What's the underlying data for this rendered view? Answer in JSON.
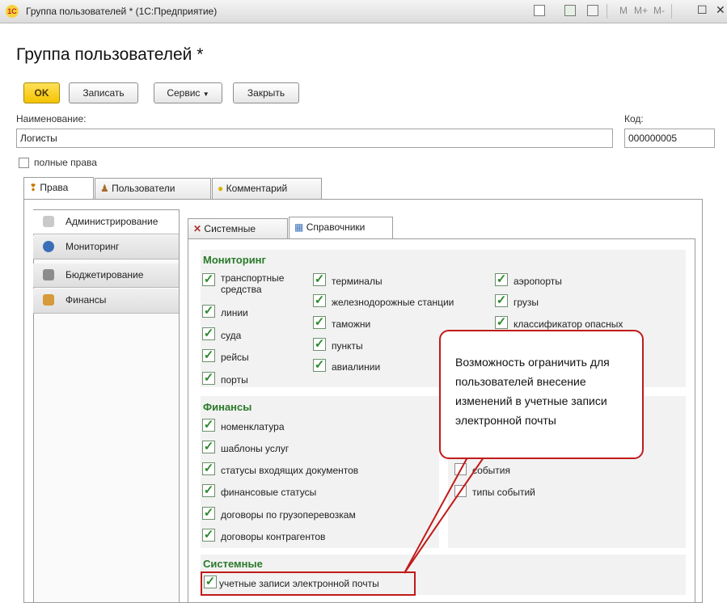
{
  "window": {
    "logo": "1С",
    "title": "Группа пользователей * (1С:Предприятие)",
    "toolbar": {
      "m": "M",
      "mplus": "M+",
      "mminus": "M-"
    }
  },
  "page": {
    "title": "Группа пользователей *"
  },
  "buttons": {
    "ok": "OK",
    "save": "Записать",
    "service": "Сервис",
    "close": "Закрыть"
  },
  "form": {
    "name_label": "Наименование:",
    "name_value": "Логисты",
    "code_label": "Код:",
    "code_value": "000000005",
    "full_rights_label": "полные права",
    "full_rights_checked": false
  },
  "tabs": [
    {
      "label": "Права",
      "icon": "pin-icon",
      "active": true
    },
    {
      "label": "Пользователи",
      "icon": "users-icon",
      "active": false
    },
    {
      "label": "Комментарий",
      "icon": "comment-icon",
      "active": false
    }
  ],
  "sidebar": [
    {
      "label": "Администрирование",
      "icon": "gear-icon",
      "active": true
    },
    {
      "label": "Мониторинг",
      "icon": "globe-icon",
      "active": false
    },
    {
      "label": "Бюджетирование",
      "icon": "calculator-icon",
      "active": false
    },
    {
      "label": "Финансы",
      "icon": "finance-icon",
      "active": false
    }
  ],
  "subtabs": [
    {
      "label": "Системные",
      "icon": "tools-icon",
      "active": false
    },
    {
      "label": "Справочники",
      "icon": "table-icon",
      "active": true
    }
  ],
  "monitoring": {
    "title": "Мониторинг",
    "col1": [
      "транспортные средства",
      "линии",
      "суда",
      "рейсы",
      "порты"
    ],
    "col2": [
      "терминалы",
      "железнодорожные станции",
      "таможни",
      "пункты",
      "авиалинии"
    ],
    "col3": [
      "аэропорты",
      "грузы",
      "классификатор опасных"
    ]
  },
  "finance": {
    "title": "Финансы",
    "items": [
      "номенклатура",
      "шаблоны услуг",
      "статусы входящих документов",
      "финансовые статусы",
      "договоры по грузоперевозкам",
      "договоры контрагентов"
    ],
    "right_items": [
      "события",
      "типы событий"
    ]
  },
  "system": {
    "title": "Системные",
    "items": [
      "учетные записи электронной почты"
    ]
  },
  "callout": {
    "text": "Возможность ограничить для пользователей внесение изменений в учетные записи электронной почты"
  },
  "colors": {
    "accent_green": "#2e8b2e",
    "callout_red": "#c11a1a",
    "ok_yellow": "#f4c300"
  }
}
